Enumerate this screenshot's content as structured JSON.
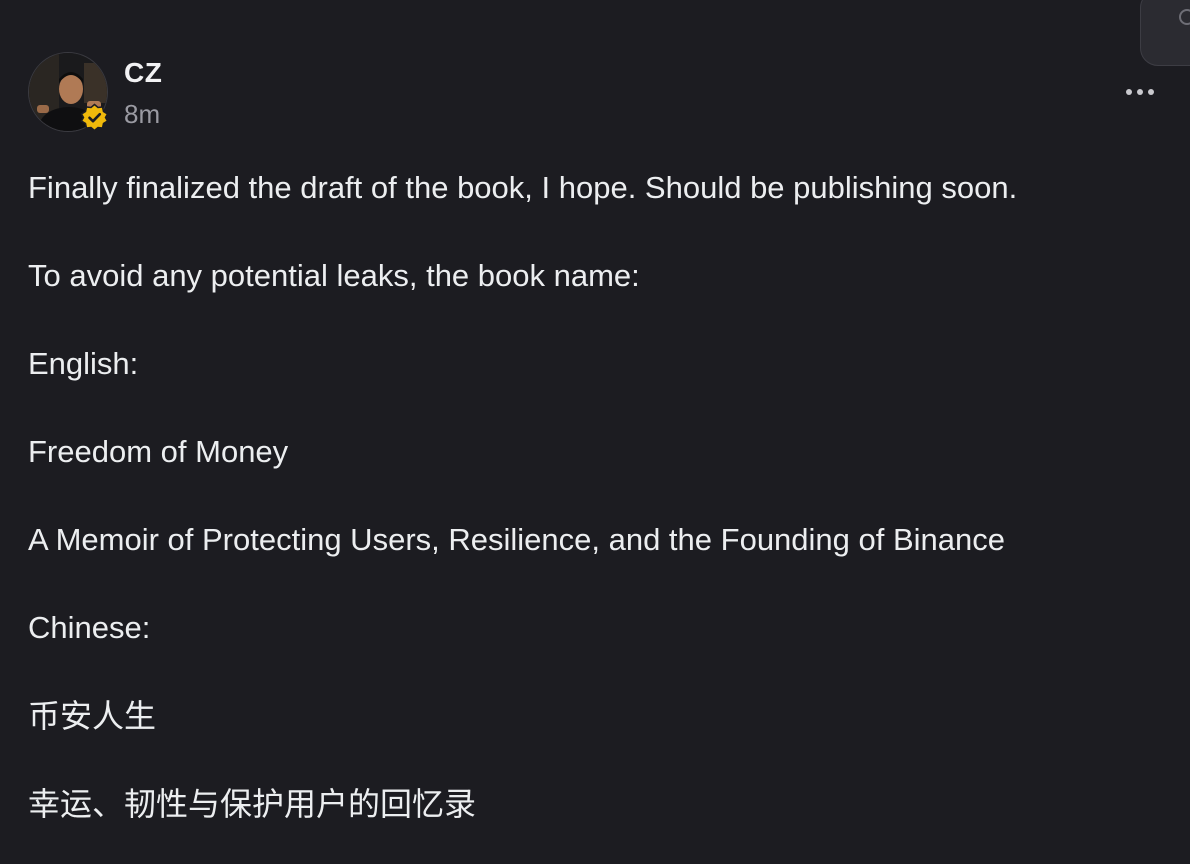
{
  "post": {
    "author": {
      "name": "CZ",
      "avatar_icon": "user-avatar-photo",
      "verified_icon": "verified-badge-icon",
      "verified_color": "#f0b90b"
    },
    "timestamp": "8m",
    "menu_icon": "more-options-icon",
    "paragraphs": [
      "Finally finalized the draft of the book, I hope. Should be publishing soon.",
      "To avoid any potential leaks, the book name:",
      "English:",
      "Freedom of Money",
      "A Memoir of Protecting Users, Resilience, and the Founding of Binance",
      "Chinese:",
      "币安人生",
      "幸运、韧性与保护用户的回忆录"
    ]
  },
  "colors": {
    "background": "#1c1c21",
    "text": "#eceef0",
    "muted": "#9a9aa2"
  }
}
